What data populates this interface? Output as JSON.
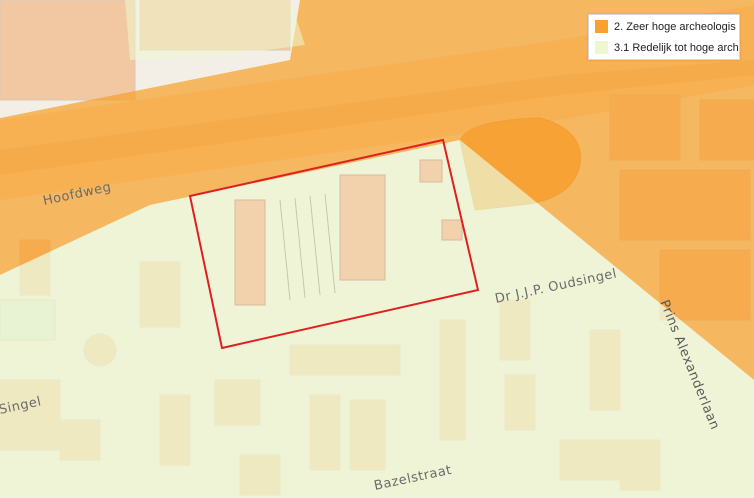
{
  "legend": {
    "items": [
      {
        "label": "2. Zeer hoge archeologis",
        "color": "#f7a12e"
      },
      {
        "label": "3.1 Redelijk tot hoge arch",
        "color": "#eef7cf"
      }
    ]
  },
  "streets": {
    "hoofdweg": "Hoofdweg",
    "oudsingel": "Dr J.J.P. Oudsingel",
    "prins_alexanderlaan": "Prins Alexanderlaan",
    "singel": "Singel",
    "bazelstraat": "Bazelstraat"
  },
  "colors": {
    "zone_high": "#f7a12e",
    "zone_moderate": "#eef7cf",
    "base": "#f4f0e8",
    "building": "#f2c8a2",
    "outline": "#e02020"
  }
}
